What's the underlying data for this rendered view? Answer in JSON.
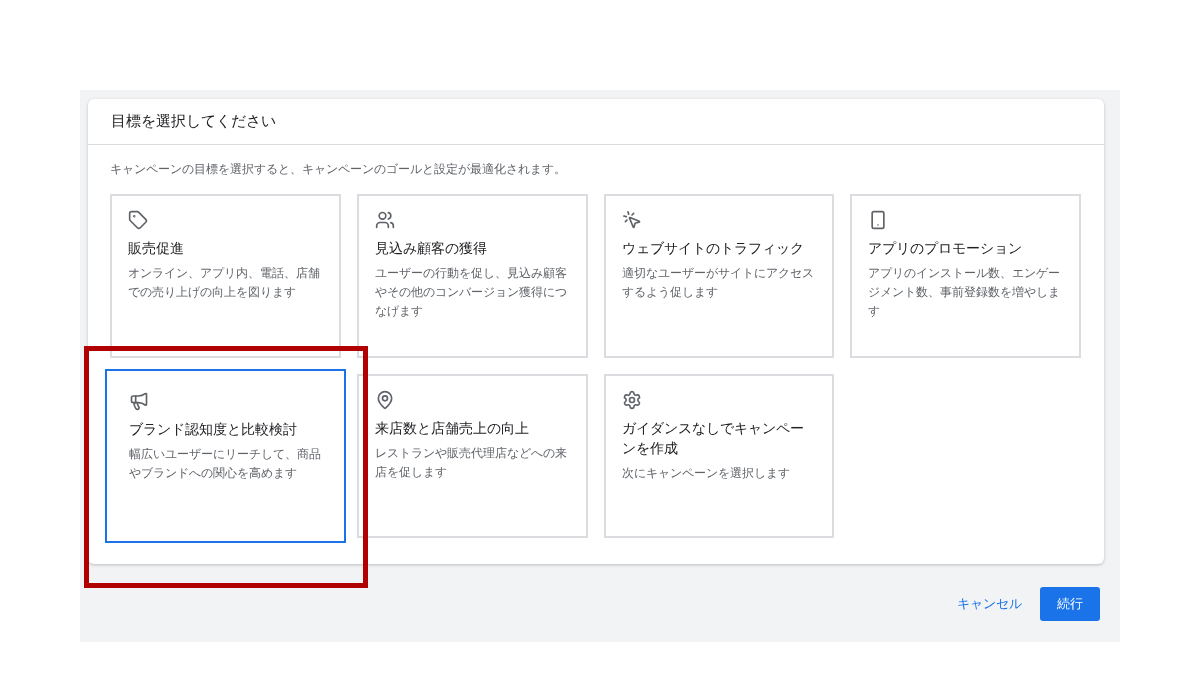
{
  "dialog": {
    "title": "目標を選択してください",
    "description": "キャンペーンの目標を選択すると、キャンペーンのゴールと設定が最適化されます。"
  },
  "goals": [
    {
      "title": "販売促進",
      "description": "オンライン、アプリ内、電話、店舗での売り上げの向上を図ります",
      "selected": false,
      "highlighted": false
    },
    {
      "title": "見込み顧客の獲得",
      "description": "ユーザーの行動を促し、見込み顧客やその他のコンバージョン獲得につなげます",
      "selected": false,
      "highlighted": false
    },
    {
      "title": "ウェブサイトのトラフィック",
      "description": "適切なユーザーがサイトにアクセスするよう促します",
      "selected": false,
      "highlighted": false
    },
    {
      "title": "アプリのプロモーション",
      "description": "アプリのインストール数、エンゲージメント数、事前登録数を増やします",
      "selected": false,
      "highlighted": false
    },
    {
      "title": "ブランド認知度と比較検討",
      "description": "幅広いユーザーにリーチして、商品やブランドへの関心を高めます",
      "selected": true,
      "highlighted": true
    },
    {
      "title": "来店数と店舗売上の向上",
      "description": "レストランや販売代理店などへの来店を促します",
      "selected": false,
      "highlighted": false
    },
    {
      "title": "ガイダンスなしでキャンペーンを作成",
      "description": "次にキャンペーンを選択します",
      "selected": false,
      "highlighted": false
    }
  ],
  "buttons": {
    "cancel": "キャンセル",
    "continue": "続行"
  }
}
